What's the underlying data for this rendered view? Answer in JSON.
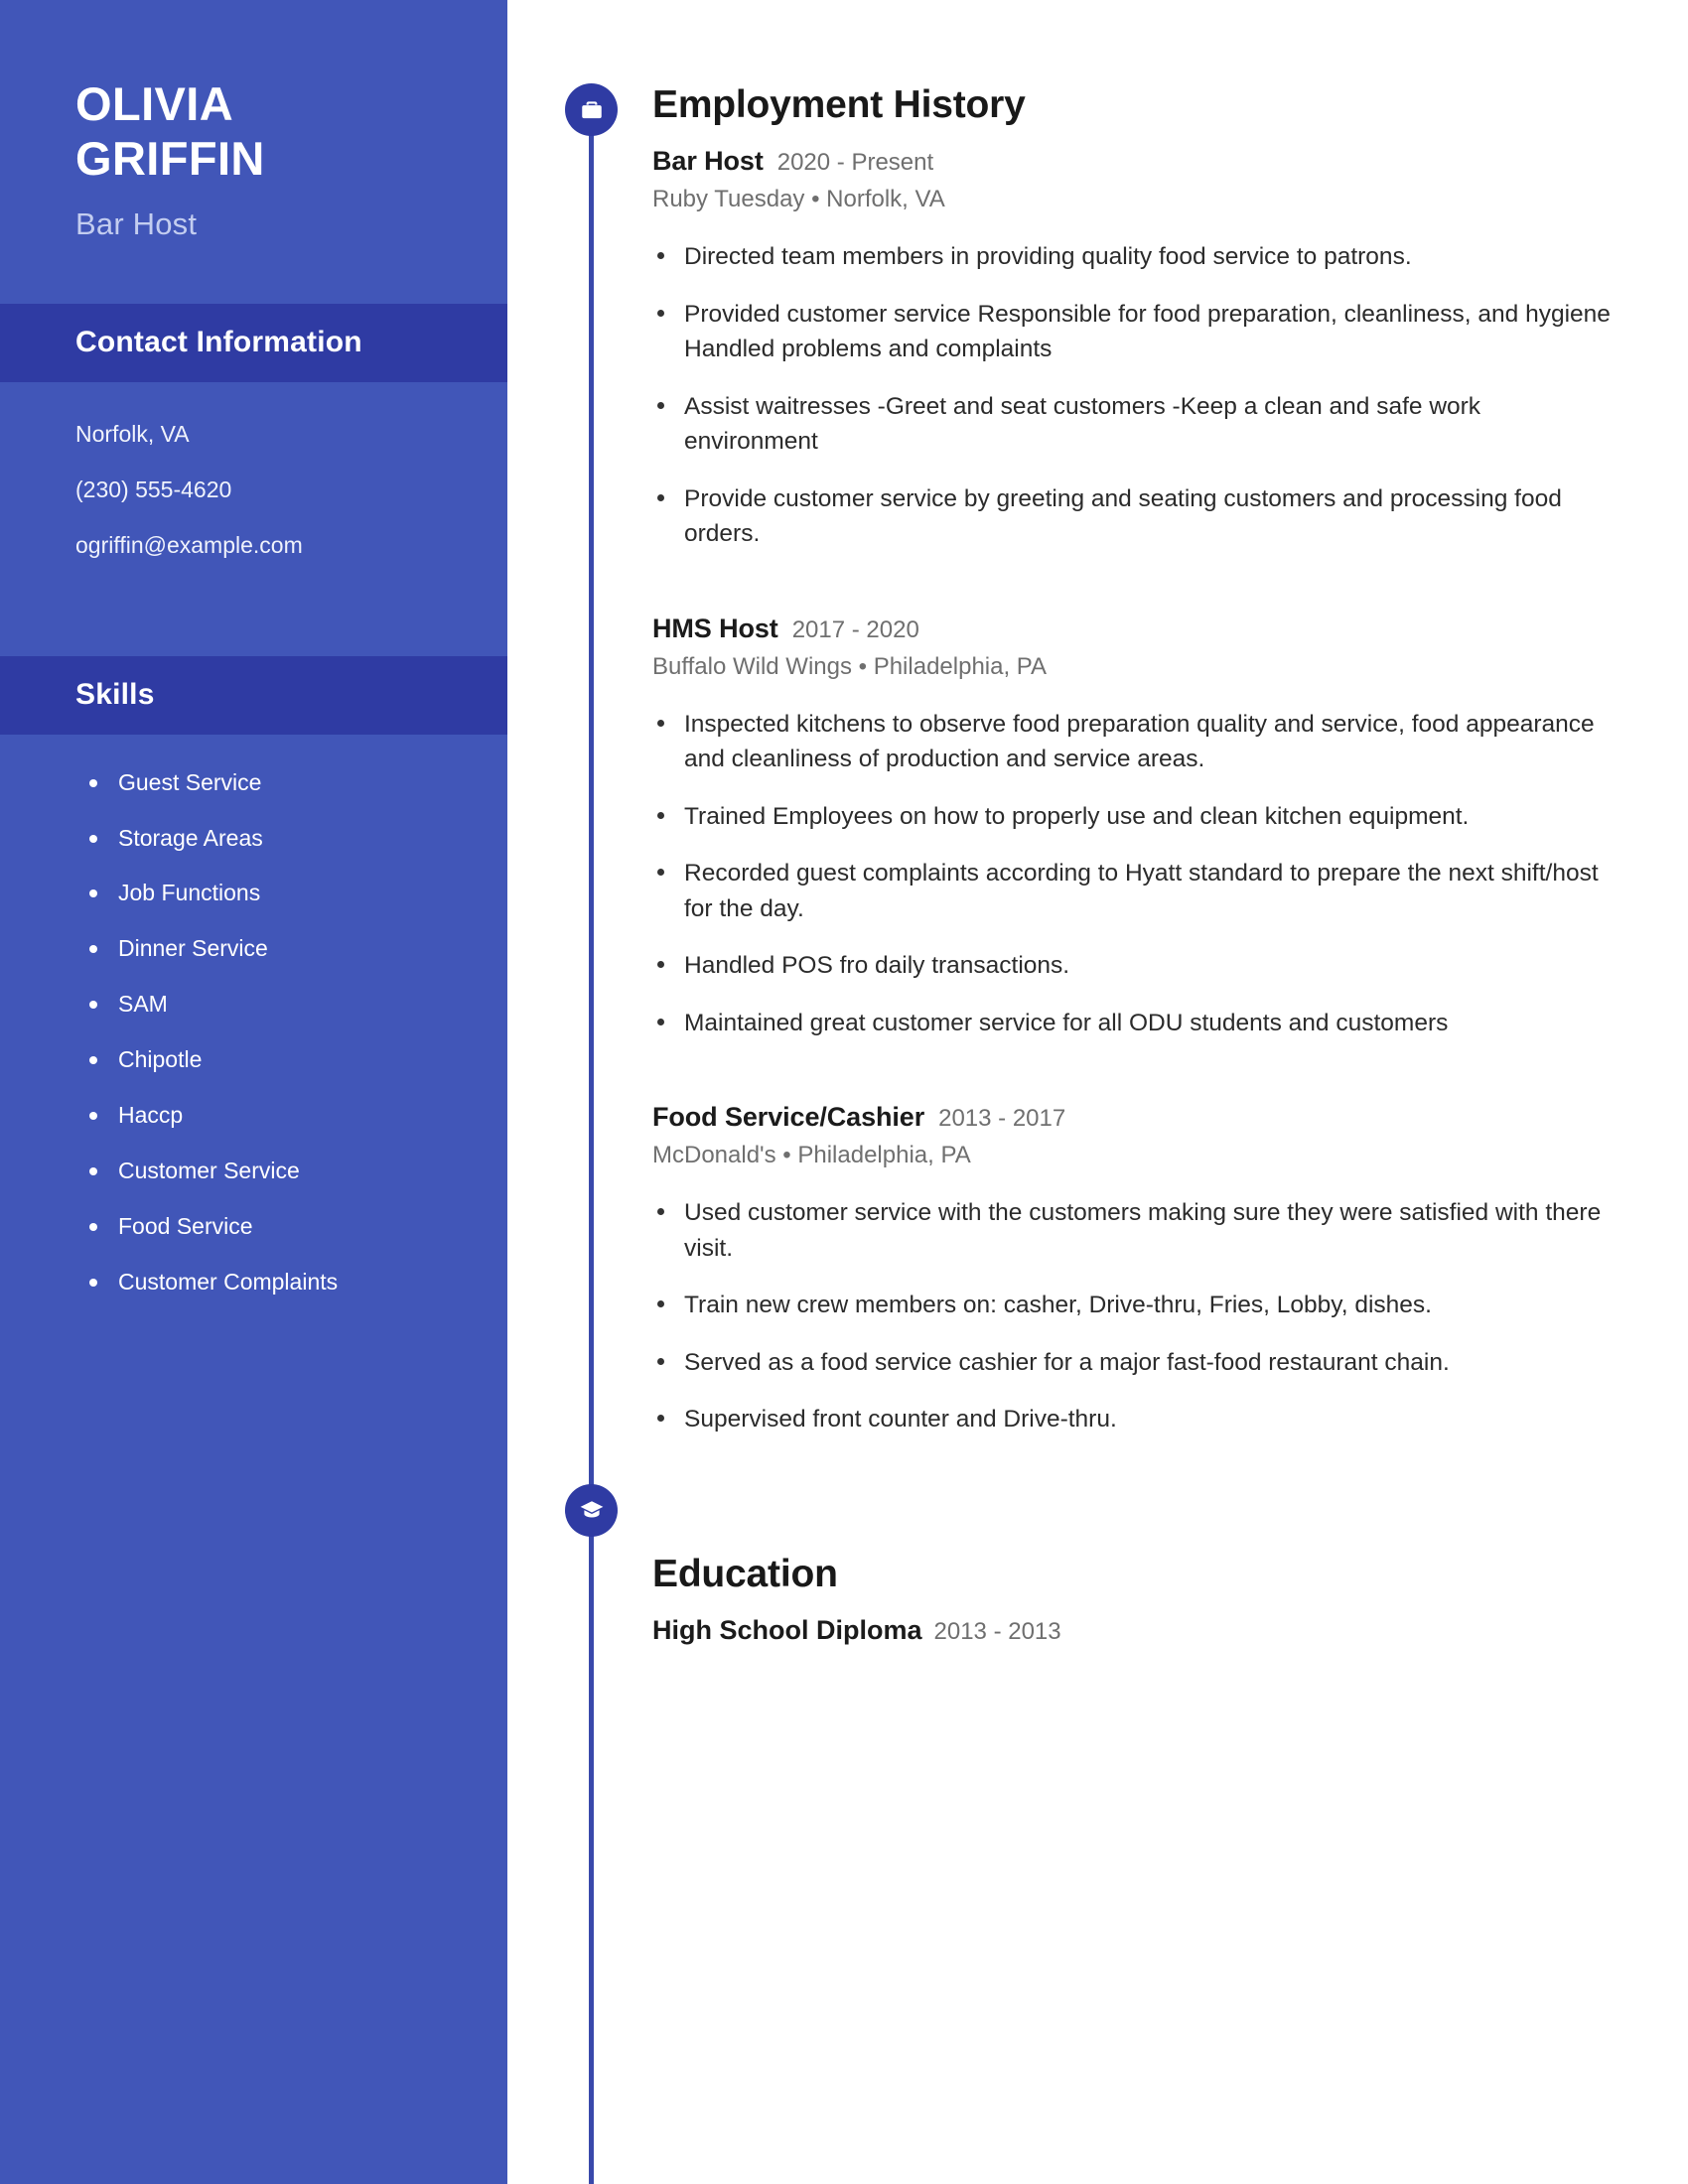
{
  "theme": {
    "sidebar_bg": "#4156b8",
    "sidebar_band_bg": "#2f3ba3",
    "accent": "#3949ab",
    "badge_bg": "#2f3ba3",
    "text_dark": "#1b1b1b",
    "text_muted": "#6f6f6f",
    "subtitle_light": "#c3cdf0"
  },
  "sidebar": {
    "name_first": "OLIVIA",
    "name_last": "GRIFFIN",
    "job_title": "Bar Host",
    "contact": {
      "heading": "Contact Information",
      "location": "Norfolk, VA",
      "phone": "(230) 555-4620",
      "email": "ogriffin@example.com"
    },
    "skills": {
      "heading": "Skills",
      "items": [
        "Guest Service",
        "Storage Areas",
        "Job Functions",
        "Dinner Service",
        "SAM",
        "Chipotle",
        "Haccp",
        "Customer Service",
        "Food Service",
        "Customer Complaints"
      ]
    }
  },
  "main": {
    "employment": {
      "heading": "Employment History",
      "icon": "briefcase-icon",
      "jobs": [
        {
          "role": "Bar Host",
          "dates": "2020 - Present",
          "meta": "Ruby Tuesday  •  Norfolk, VA",
          "bullets": [
            "Directed team members in providing quality food service to patrons.",
            "Provided customer service Responsible for food preparation, cleanliness, and hygiene Handled problems and complaints",
            "Assist waitresses -Greet and seat customers -Keep a clean and safe work environment",
            "Provide customer service by greeting and seating customers and processing food orders."
          ]
        },
        {
          "role": "HMS Host",
          "dates": "2017 - 2020",
          "meta": "Buffalo Wild Wings  •  Philadelphia, PA",
          "bullets": [
            "Inspected kitchens to observe food preparation quality and service, food appearance and cleanliness of production and service areas.",
            "Trained Employees on how to properly use and clean kitchen equipment.",
            "Recorded guest complaints according to Hyatt standard to prepare the next shift/host for the day.",
            "Handled POS fro daily transactions.",
            "Maintained great customer service for all ODU students and customers"
          ]
        },
        {
          "role": "Food Service/Cashier",
          "dates": "2013 - 2017",
          "meta": "McDonald's  •  Philadelphia, PA",
          "bullets": [
            "Used customer service with the customers making sure they were satisfied with there visit.",
            "Train new crew members on: casher, Drive-thru, Fries, Lobby, dishes.",
            "Served as a food service cashier for a major fast-food restaurant chain.",
            "Supervised front counter and Drive-thru."
          ]
        }
      ]
    },
    "education": {
      "heading": "Education",
      "icon": "graduation-cap-icon",
      "entries": [
        {
          "degree": "High School Diploma",
          "dates": "2013 - 2013"
        }
      ]
    }
  }
}
